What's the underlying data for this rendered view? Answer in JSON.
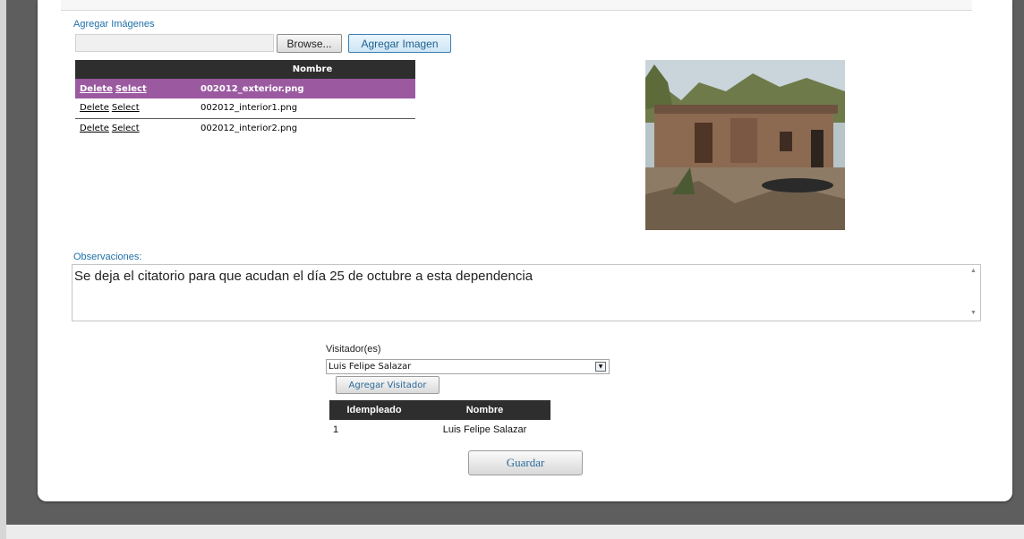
{
  "images_section": {
    "label": "Agregar Imágenes",
    "browse_label": "Browse...",
    "add_image_label": "Agregar Imagen",
    "table": {
      "header": "Nombre",
      "rows": [
        {
          "delete": "Delete",
          "select": "Select",
          "name": "002012_exterior.png",
          "selected": true
        },
        {
          "delete": "Delete",
          "select": "Select",
          "name": "002012_interior1.png",
          "selected": false
        },
        {
          "delete": "Delete",
          "select": "Select",
          "name": "002012_interior2.png",
          "selected": false
        }
      ]
    }
  },
  "observaciones": {
    "label": "Observaciones:",
    "value": "Se deja el citatorio para que acudan el día 25 de octubre a esta dependencia"
  },
  "visitadores": {
    "label": "Visitador(es)",
    "selected": "Luis Felipe Salazar",
    "add_label": "Agregar Visitador",
    "table": {
      "headers": [
        "Idempleado",
        "Nombre"
      ],
      "rows": [
        {
          "id": "1",
          "name": "Luis Felipe Salazar"
        }
      ]
    }
  },
  "save_label": "Guardar",
  "colors": {
    "selected_row": "#9b5aa0",
    "header_dark": "#2e2e2e",
    "link_blue": "#1f6fa8"
  }
}
